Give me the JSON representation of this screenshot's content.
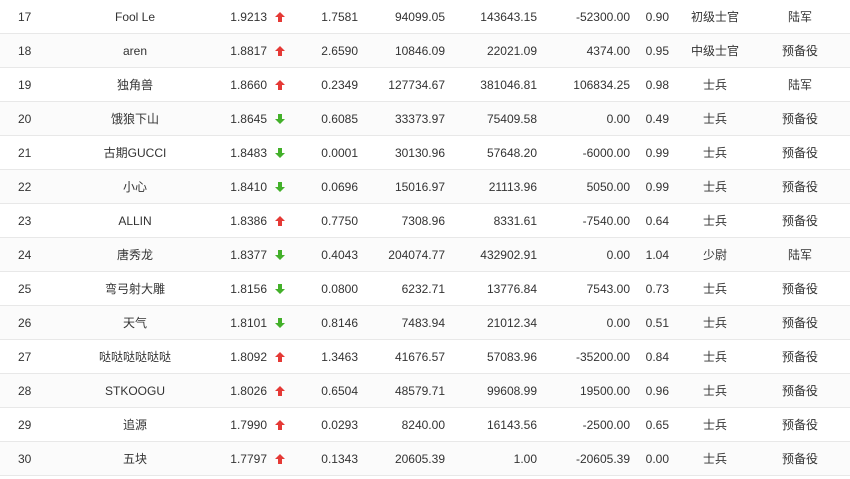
{
  "colors": {
    "up": "#e53935",
    "down": "#43b02a",
    "text": "#333333",
    "border": "#e8e8e8"
  },
  "rows": [
    {
      "rank": "17",
      "name": "Fool Le",
      "score": "1.9213",
      "trend": "up",
      "v1": "1.7581",
      "v2": "94099.05",
      "v3": "143643.15",
      "v4": "-52300.00",
      "v5": "0.90",
      "title": "初级士官",
      "branch": "陆军"
    },
    {
      "rank": "18",
      "name": "aren",
      "score": "1.8817",
      "trend": "up",
      "v1": "2.6590",
      "v2": "10846.09",
      "v3": "22021.09",
      "v4": "4374.00",
      "v5": "0.95",
      "title": "中级士官",
      "branch": "预备役"
    },
    {
      "rank": "19",
      "name": "独角兽",
      "score": "1.8660",
      "trend": "up",
      "v1": "0.2349",
      "v2": "127734.67",
      "v3": "381046.81",
      "v4": "106834.25",
      "v5": "0.98",
      "title": "士兵",
      "branch": "陆军"
    },
    {
      "rank": "20",
      "name": "饿狼下山",
      "score": "1.8645",
      "trend": "down",
      "v1": "0.6085",
      "v2": "33373.97",
      "v3": "75409.58",
      "v4": "0.00",
      "v5": "0.49",
      "title": "士兵",
      "branch": "预备役"
    },
    {
      "rank": "21",
      "name": "古期GUCCI",
      "score": "1.8483",
      "trend": "down",
      "v1": "0.0001",
      "v2": "30130.96",
      "v3": "57648.20",
      "v4": "-6000.00",
      "v5": "0.99",
      "title": "士兵",
      "branch": "预备役"
    },
    {
      "rank": "22",
      "name": "小心",
      "score": "1.8410",
      "trend": "down",
      "v1": "0.0696",
      "v2": "15016.97",
      "v3": "21113.96",
      "v4": "5050.00",
      "v5": "0.99",
      "title": "士兵",
      "branch": "预备役"
    },
    {
      "rank": "23",
      "name": "ALLIN",
      "score": "1.8386",
      "trend": "up",
      "v1": "0.7750",
      "v2": "7308.96",
      "v3": "8331.61",
      "v4": "-7540.00",
      "v5": "0.64",
      "title": "士兵",
      "branch": "预备役"
    },
    {
      "rank": "24",
      "name": "唐秀龙",
      "score": "1.8377",
      "trend": "down",
      "v1": "0.4043",
      "v2": "204074.77",
      "v3": "432902.91",
      "v4": "0.00",
      "v5": "1.04",
      "title": "少尉",
      "branch": "陆军"
    },
    {
      "rank": "25",
      "name": "弯弓射大雕",
      "score": "1.8156",
      "trend": "down",
      "v1": "0.0800",
      "v2": "6232.71",
      "v3": "13776.84",
      "v4": "7543.00",
      "v5": "0.73",
      "title": "士兵",
      "branch": "预备役"
    },
    {
      "rank": "26",
      "name": "天气",
      "score": "1.8101",
      "trend": "down",
      "v1": "0.8146",
      "v2": "7483.94",
      "v3": "21012.34",
      "v4": "0.00",
      "v5": "0.51",
      "title": "士兵",
      "branch": "预备役"
    },
    {
      "rank": "27",
      "name": "哒哒哒哒哒哒",
      "score": "1.8092",
      "trend": "up",
      "v1": "1.3463",
      "v2": "41676.57",
      "v3": "57083.96",
      "v4": "-35200.00",
      "v5": "0.84",
      "title": "士兵",
      "branch": "预备役"
    },
    {
      "rank": "28",
      "name": "STKOOGU",
      "score": "1.8026",
      "trend": "up",
      "v1": "0.6504",
      "v2": "48579.71",
      "v3": "99608.99",
      "v4": "19500.00",
      "v5": "0.96",
      "title": "士兵",
      "branch": "预备役"
    },
    {
      "rank": "29",
      "name": "追源",
      "score": "1.7990",
      "trend": "up",
      "v1": "0.0293",
      "v2": "8240.00",
      "v3": "16143.56",
      "v4": "-2500.00",
      "v5": "0.65",
      "title": "士兵",
      "branch": "预备役"
    },
    {
      "rank": "30",
      "name": "五块",
      "score": "1.7797",
      "trend": "up",
      "v1": "0.1343",
      "v2": "20605.39",
      "v3": "1.00",
      "v4": "-20605.39",
      "v5": "0.00",
      "title": "士兵",
      "branch": "预备役"
    }
  ]
}
